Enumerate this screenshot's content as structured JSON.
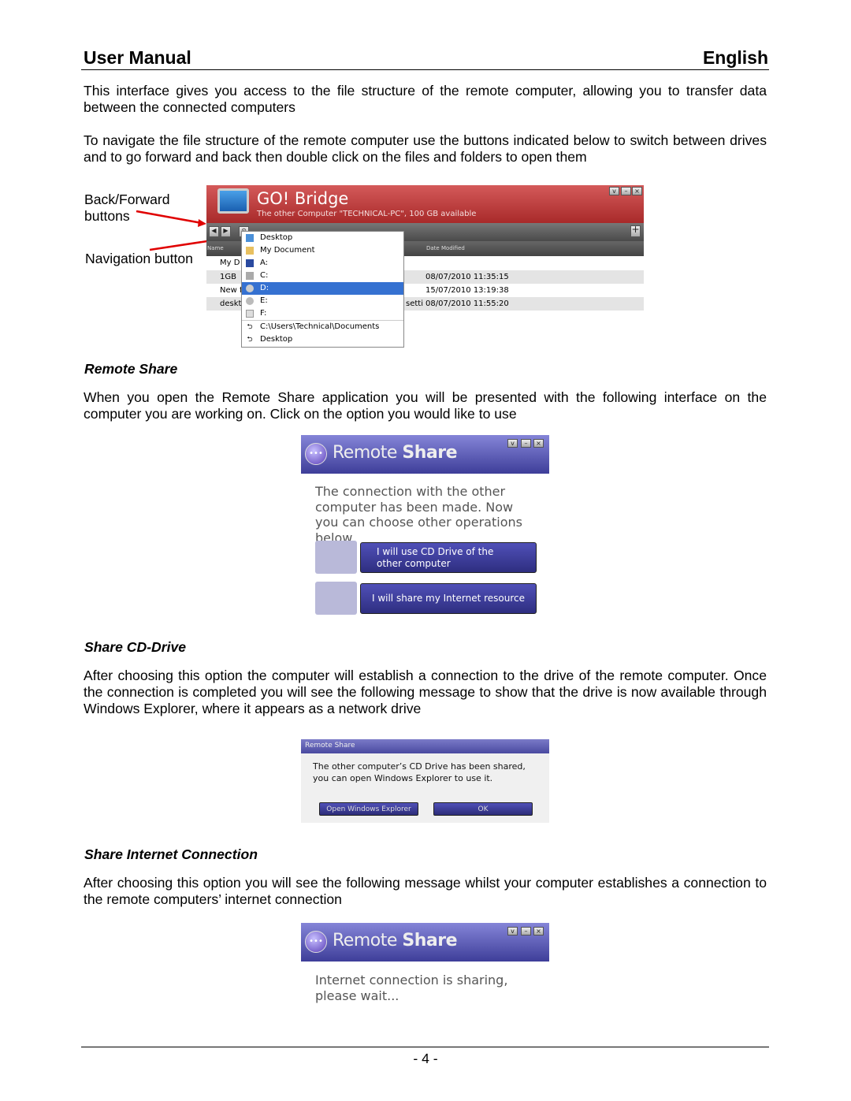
{
  "header": {
    "left": "User Manual",
    "right": "English"
  },
  "intro": {
    "p1": "This interface gives you access to the file structure of the remote computer, allowing you to transfer data between the connected computers",
    "p2": "To navigate the file structure of the remote computer use the buttons indicated below to switch between drives and to go forward and back then double click on the files and folders to open them"
  },
  "callouts": {
    "back_forward": "Back/Forward buttons",
    "navigation": "Navigation button"
  },
  "go_bridge": {
    "title": "GO! Bridge",
    "subtitle": "The other Computer \"TECHNICAL-PC\", 100 GB available",
    "path_partial": "Desktop",
    "columns": {
      "name": "Name",
      "date": "Date Modified"
    },
    "rows": [
      {
        "name": "My D",
        "type": "",
        "date": ""
      },
      {
        "name": "1GB",
        "type": "",
        "date": "08/07/2010 11:35:15"
      },
      {
        "name": "New f",
        "type": "",
        "date": "15/07/2010 13:19:38"
      },
      {
        "name": "deskt",
        "type": "setti",
        "date": "08/07/2010 11:55:20"
      }
    ],
    "dropdown": [
      "Desktop",
      "My Document",
      "A:",
      "C:",
      "D:",
      "E:",
      "F:",
      "C:\\Users\\Technical\\Documents",
      "Desktop"
    ],
    "selected": "D:"
  },
  "remote_share": {
    "heading": "Remote Share",
    "text": "When you open the Remote Share application you will be presented with the following interface on the computer you are working on. Click on the option you would like to use",
    "dialog": {
      "title_light": "Remote",
      "title_bold": "Share",
      "message": "The connection with the other computer has been made. Now you can choose other operations below.",
      "btn_cd": "I will use CD Drive of the other computer",
      "btn_internet": "I will share my Internet resource"
    }
  },
  "share_cd": {
    "heading": "Share CD-Drive",
    "text": "After choosing this option the computer will establish a connection to the drive of the remote computer. Once the connection is completed you will see the following message to show that the drive is now available through Windows Explorer, where it appears as a network drive",
    "dialog": {
      "title": "Remote Share",
      "message": "The other computer’s CD Drive has been shared, you can open Windows Explorer to use it.",
      "btn_open": "Open Windows Explorer",
      "btn_ok": "OK"
    }
  },
  "share_internet": {
    "heading": "Share Internet Connection",
    "text": "After choosing this option you will see the following message whilst your computer establishes a connection to the remote computers’ internet connection",
    "dialog": {
      "title_light": "Remote",
      "title_bold": "Share",
      "message": "Internet connection is sharing, please wait..."
    }
  },
  "footer": {
    "page": "- 4 -"
  },
  "colors": {
    "go_bridge_red": "#b53535",
    "remote_share_blue": "#3e3e99",
    "selection": "#3571d1",
    "arrow": "#e00000"
  }
}
